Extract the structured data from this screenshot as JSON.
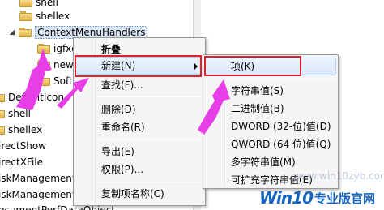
{
  "tree": {
    "nodes": [
      {
        "label": "shell",
        "indent": 1
      },
      {
        "label": "shellex",
        "indent": 1
      },
      {
        "label": "ContextMenuHandlers",
        "indent": 2
      },
      {
        "label": "igfxc",
        "indent": 3
      },
      {
        "label": "new",
        "indent": 3
      },
      {
        "label": "Soft",
        "indent": 3
      },
      {
        "label": "DefaultIcon",
        "indent": 1
      },
      {
        "label": "shell",
        "indent": 1
      },
      {
        "label": "shellex",
        "indent": 1
      },
      {
        "label": "irectShow",
        "indent": 0
      },
      {
        "label": "irectXFile",
        "indent": 0
      },
      {
        "label": "iskManagement",
        "indent": 0
      },
      {
        "label": "iskManagement",
        "indent": 0
      },
      {
        "label": "ocumentPerfDataObject",
        "indent": 0
      }
    ],
    "expander_symbol": "◢"
  },
  "context_menu": {
    "collapse": "折叠",
    "new": "新建(N)",
    "find": "查找(F)...",
    "delete": "删除(D)",
    "rename": "重命名(R)",
    "export": "导出(E)",
    "permissions": "权限(P)...",
    "copy_key_name": "复制项名称(C)"
  },
  "new_submenu": {
    "key": "项(K)",
    "string_value": "字符串值(S)",
    "binary_value": "二进制值(B)",
    "dword_value": "DWORD (32-位)值(D)",
    "qword_value": "QWORD (64 位)值(Q)",
    "multi_string_value": "多字符串值(M)",
    "expandable_string_value": "可扩充字符串值(E)"
  },
  "watermark": {
    "faint_text": "www.win10zyb.com",
    "logo": "Win10",
    "subtitle": "专业版官网"
  },
  "colors": {
    "highlight_box": "#e1202a",
    "annotation_arrow": "#e83ee8",
    "watermark": "#1565c0"
  }
}
